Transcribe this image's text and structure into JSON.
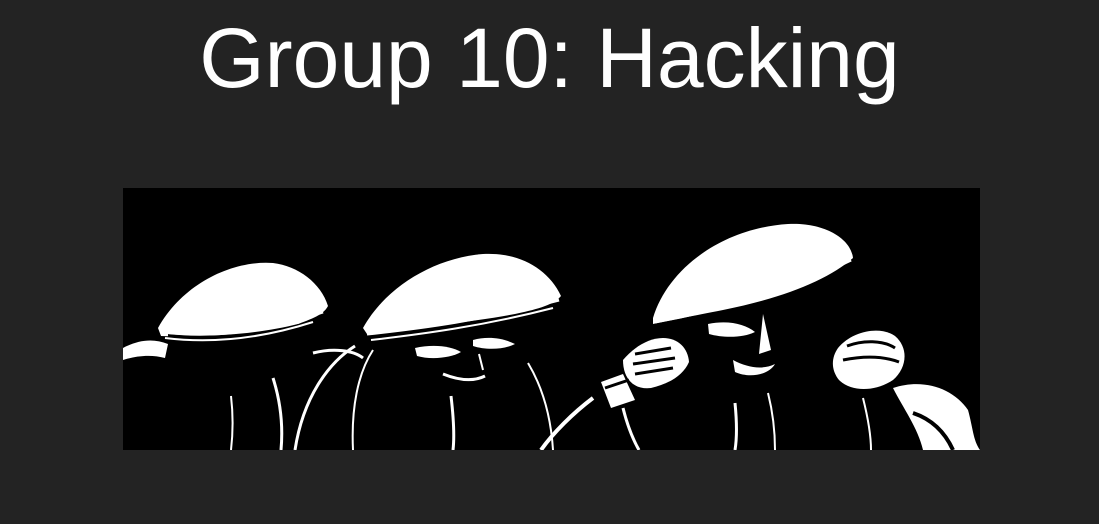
{
  "slide": {
    "title": "Group 10: Hacking"
  },
  "colors": {
    "background": "#232323",
    "title_text": "#ffffff",
    "image_background": "#000000",
    "ink_white": "#ffffff"
  },
  "illustration": {
    "subject": "three-hooded-figures",
    "style": "black-and-white-ink-drawing"
  }
}
